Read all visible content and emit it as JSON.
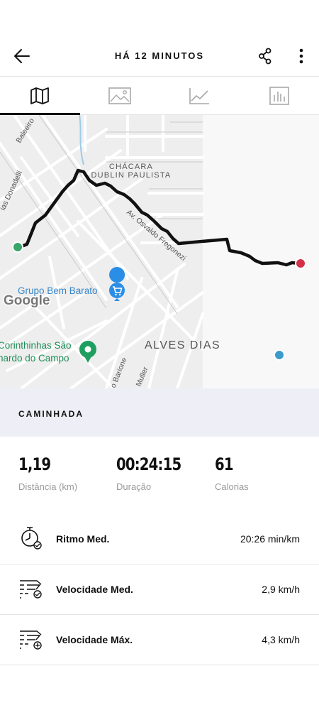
{
  "header": {
    "title": "HÁ 12 MINUTOS",
    "back_icon": "arrow-left-icon",
    "share_icon": "share-icon",
    "more_icon": "more-vertical-icon"
  },
  "tabs": [
    {
      "icon": "map-icon",
      "active": true
    },
    {
      "icon": "photo-icon",
      "active": false
    },
    {
      "icon": "line-chart-icon",
      "active": false
    },
    {
      "icon": "bar-chart-icon",
      "active": false
    }
  ],
  "map": {
    "labels": {
      "chacara_line1": "CHÁCARA",
      "chacara_line2": "DUBLIN PAULISTA",
      "avenue": "Av. Osvaldo Fregonezi",
      "grupo": "Grupo Bem Barato",
      "corinthinhas_line1": "Corinthinhas São",
      "corinthinhas_line2": "nardo do Campo",
      "alves_dias": "ALVES DIAS",
      "baleeiro": "Baleeiro",
      "donadelli": "ias Donadelli",
      "barione": "o Barione",
      "muller": "Muller",
      "google": "Google"
    },
    "colors": {
      "route": "#111111",
      "start": "#3aa46a",
      "end": "#d5304a",
      "position": "#3b9ccc",
      "poi_blue": "#2b8ee6",
      "poi_green": "#1e9e5f"
    }
  },
  "activity": {
    "type": "CAMINHADA"
  },
  "stats": [
    {
      "value": "1,19",
      "label": "Distância (km)"
    },
    {
      "value": "00:24:15",
      "label": "Duração"
    },
    {
      "value": "61",
      "label": "Calorias"
    }
  ],
  "metrics": [
    {
      "icon": "stopwatch-icon",
      "label": "Ritmo Med.",
      "value": "20:26 min/km"
    },
    {
      "icon": "speed-average-icon",
      "label": "Velocidade Med.",
      "value": "2,9 km/h"
    },
    {
      "icon": "speed-max-icon",
      "label": "Velocidade Máx.",
      "value": "4,3 km/h"
    }
  ]
}
